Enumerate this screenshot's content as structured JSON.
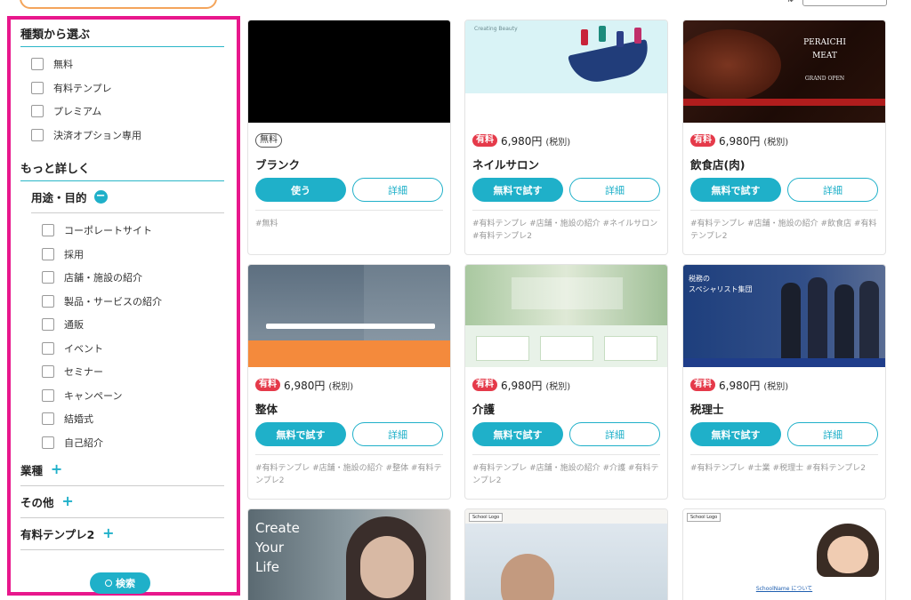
{
  "sidebar": {
    "type_title": "種類から選ぶ",
    "type_options": [
      "無料",
      "有料テンプレ",
      "プレミアム",
      "決済オプション専用"
    ],
    "more_title": "もっと詳しく",
    "purpose_label": "用途・目的",
    "purpose_toggle": "−",
    "purpose_options": [
      "コーポレートサイト",
      "採用",
      "店舗・施設の紹介",
      "製品・サービスの紹介",
      "通販",
      "イベント",
      "セミナー",
      "キャンペーン",
      "結婚式",
      "自己紹介"
    ],
    "industry_label": "業種",
    "other_label": "その他",
    "paid2_label": "有料テンプレ2",
    "expand_symbol": "+",
    "search_label": "検索"
  },
  "cards": [
    {
      "badge": "無料",
      "price": "",
      "tax": "",
      "title": "ブランク",
      "primary": "使う",
      "secondary": "詳細",
      "tags": "#無料"
    },
    {
      "badge": "有料",
      "price": "6,980円",
      "tax": "(税別)",
      "title": "ネイルサロン",
      "primary": "無料で試す",
      "secondary": "詳細",
      "tags": "#有料テンプレ #店舗・施設の紹介 #ネイルサロン #有料テンプレ2",
      "thumb_text": "Creating Beauty"
    },
    {
      "badge": "有料",
      "price": "6,980円",
      "tax": "(税別)",
      "title": "飲食店(肉)",
      "primary": "無料で試す",
      "secondary": "詳細",
      "tags": "#有料テンプレ #店舗・施設の紹介 #飲食店 #有料テンプレ2",
      "thumb_text": "PERAICHI\nMEAT",
      "thumb_sub": "GRAND OPEN"
    },
    {
      "badge": "有料",
      "price": "6,980円",
      "tax": "(税別)",
      "title": "整体",
      "primary": "無料で試す",
      "secondary": "詳細",
      "tags": "#有料テンプレ #店舗・施設の紹介 #整体 #有料テンプレ2"
    },
    {
      "badge": "有料",
      "price": "6,980円",
      "tax": "(税別)",
      "title": "介護",
      "primary": "無料で試す",
      "secondary": "詳細",
      "tags": "#有料テンプレ #店舗・施設の紹介 #介護 #有料テンプレ2"
    },
    {
      "badge": "有料",
      "price": "6,980円",
      "tax": "(税別)",
      "title": "税理士",
      "primary": "無料で試す",
      "secondary": "詳細",
      "tags": "#有料テンプレ #士業 #税理士 #有料テンプレ2",
      "thumb_text": "税務の\nスペシャリスト集団"
    },
    {
      "thumb_text": "Create\nYour\nLife"
    },
    {
      "thumb_text": "School Logo"
    },
    {
      "thumb_text": "School Logo",
      "thumb_sub": "SchoolName について"
    }
  ],
  "colors": {
    "accent": "#1fb0c9",
    "paid_badge": "#e53a4a",
    "highlight_border": "#e8178c"
  }
}
